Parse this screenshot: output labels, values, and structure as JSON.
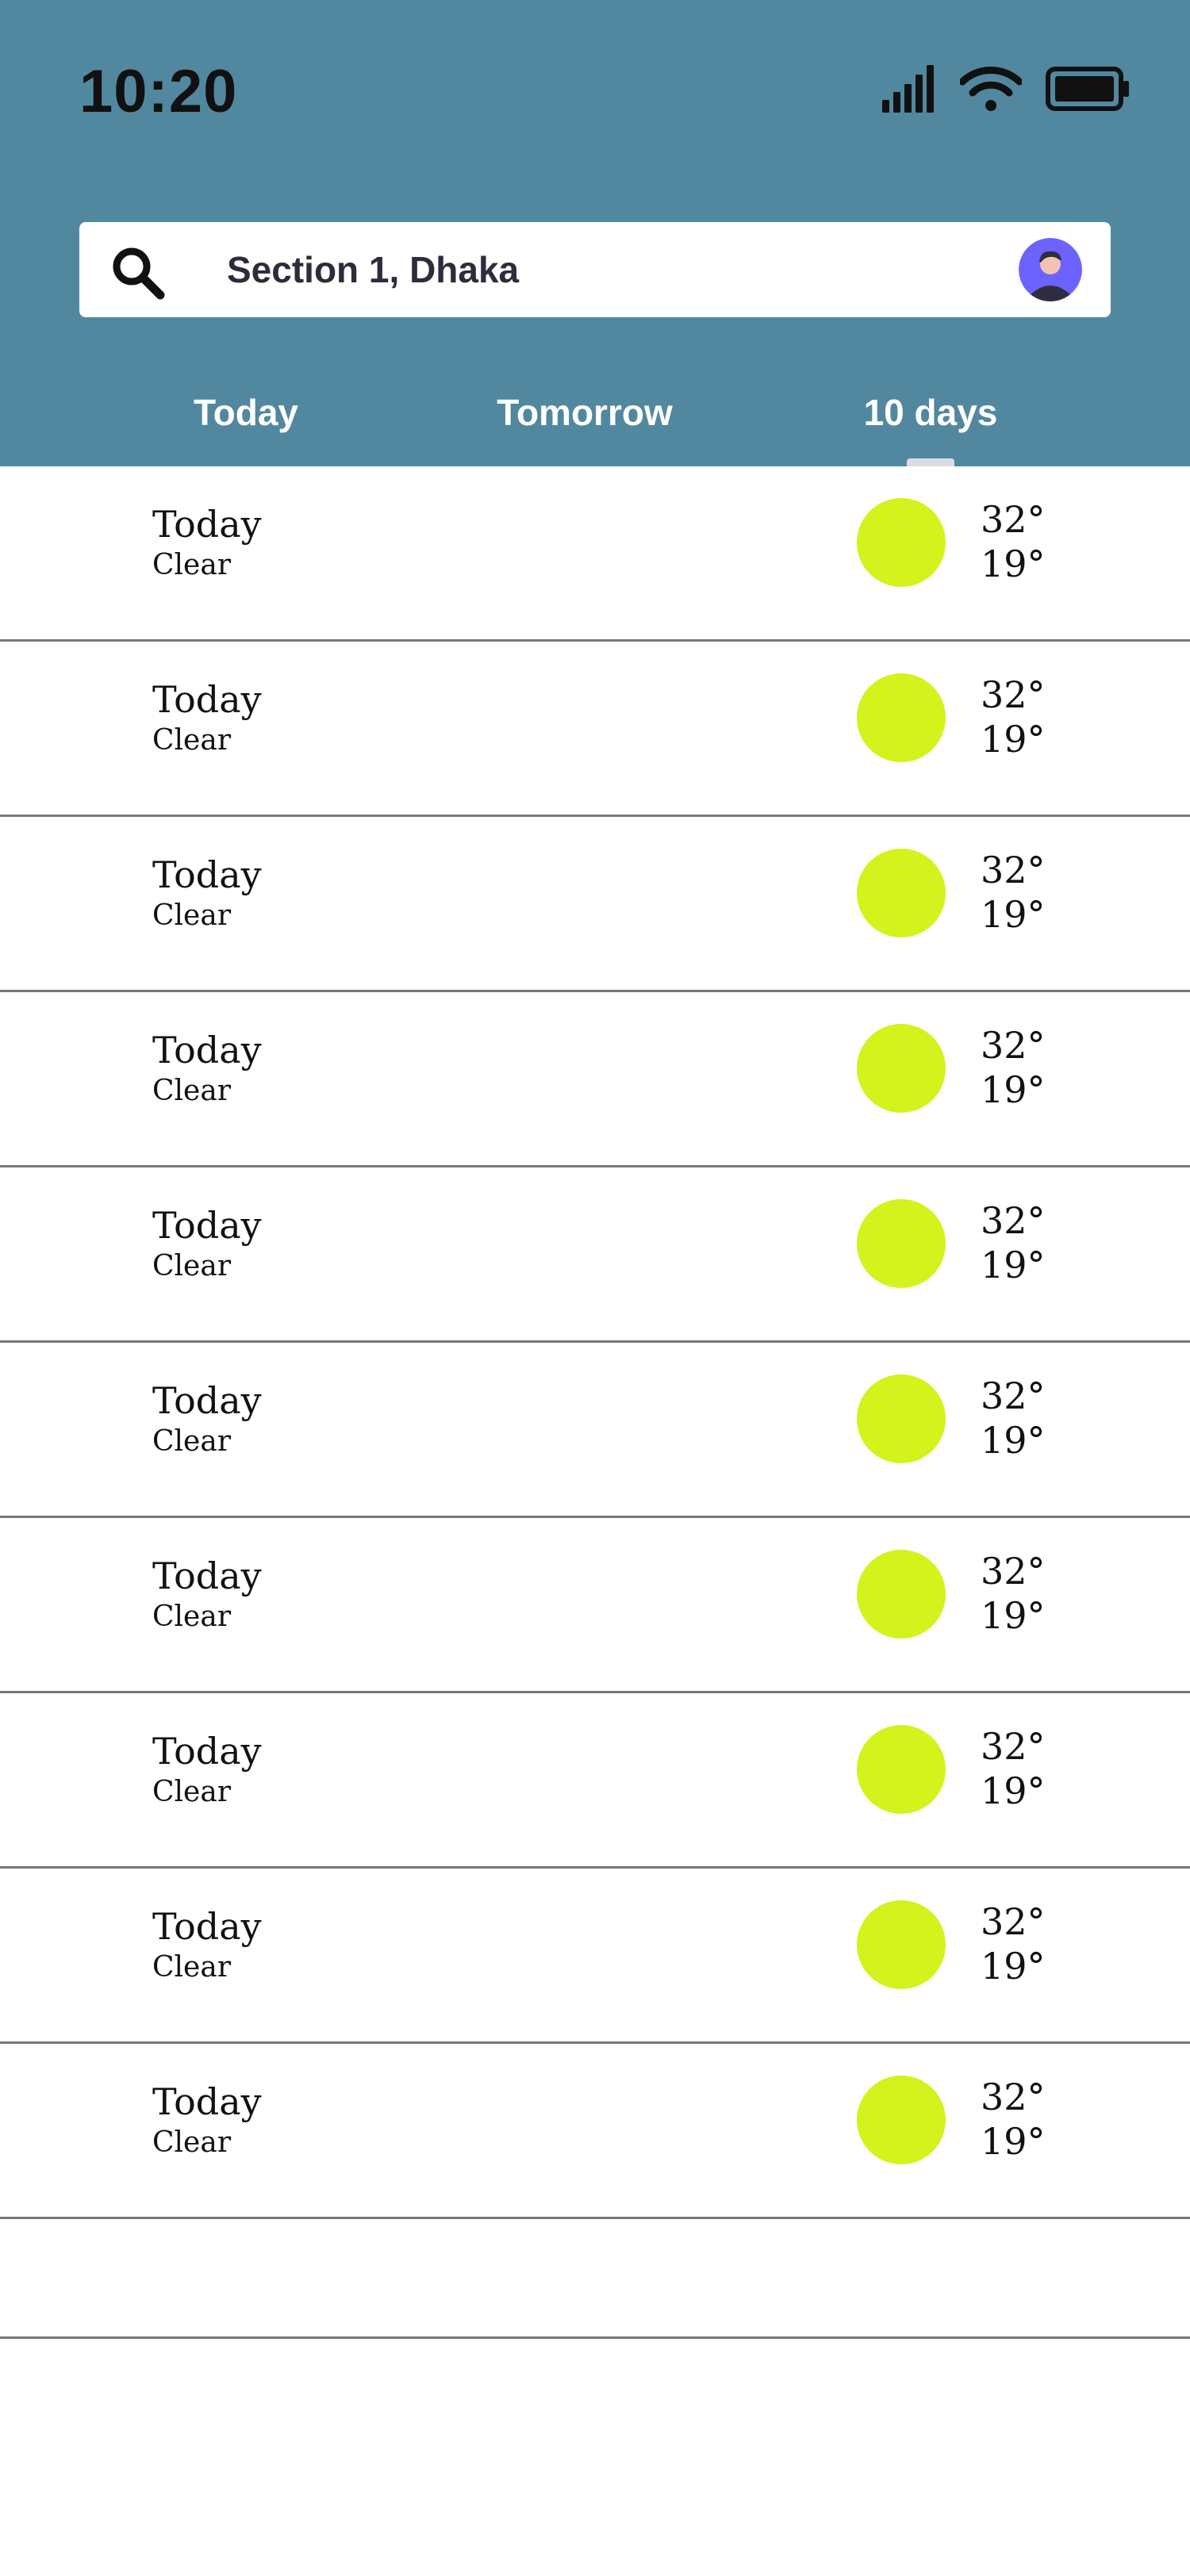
{
  "status_bar": {
    "time": "10:20",
    "icons": [
      "signal-icon",
      "wifi-icon",
      "battery-icon"
    ]
  },
  "search": {
    "icon": "search-icon",
    "value": "Section 1, Dhaka",
    "avatar_icon": "avatar"
  },
  "tabs": [
    {
      "label": "Today",
      "active": false
    },
    {
      "label": "Tomorrow",
      "active": false
    },
    {
      "label": "10 days",
      "active": true
    }
  ],
  "forecast": [
    {
      "day": "Today",
      "condition": "Clear",
      "high": "32°",
      "low": "19°",
      "icon": "sun-icon"
    },
    {
      "day": "Today",
      "condition": "Clear",
      "high": "32°",
      "low": "19°",
      "icon": "sun-icon"
    },
    {
      "day": "Today",
      "condition": "Clear",
      "high": "32°",
      "low": "19°",
      "icon": "sun-icon"
    },
    {
      "day": "Today",
      "condition": "Clear",
      "high": "32°",
      "low": "19°",
      "icon": "sun-icon"
    },
    {
      "day": "Today",
      "condition": "Clear",
      "high": "32°",
      "low": "19°",
      "icon": "sun-icon"
    },
    {
      "day": "Today",
      "condition": "Clear",
      "high": "32°",
      "low": "19°",
      "icon": "sun-icon"
    },
    {
      "day": "Today",
      "condition": "Clear",
      "high": "32°",
      "low": "19°",
      "icon": "sun-icon"
    },
    {
      "day": "Today",
      "condition": "Clear",
      "high": "32°",
      "low": "19°",
      "icon": "sun-icon"
    },
    {
      "day": "Today",
      "condition": "Clear",
      "high": "32°",
      "low": "19°",
      "icon": "sun-icon"
    },
    {
      "day": "Today",
      "condition": "Clear",
      "high": "32°",
      "low": "19°",
      "icon": "sun-icon"
    }
  ],
  "colors": {
    "header_bg": "#52889f",
    "sun": "#d4f21c",
    "divider": "#777777",
    "tab_indicator": "#d9dde3"
  }
}
